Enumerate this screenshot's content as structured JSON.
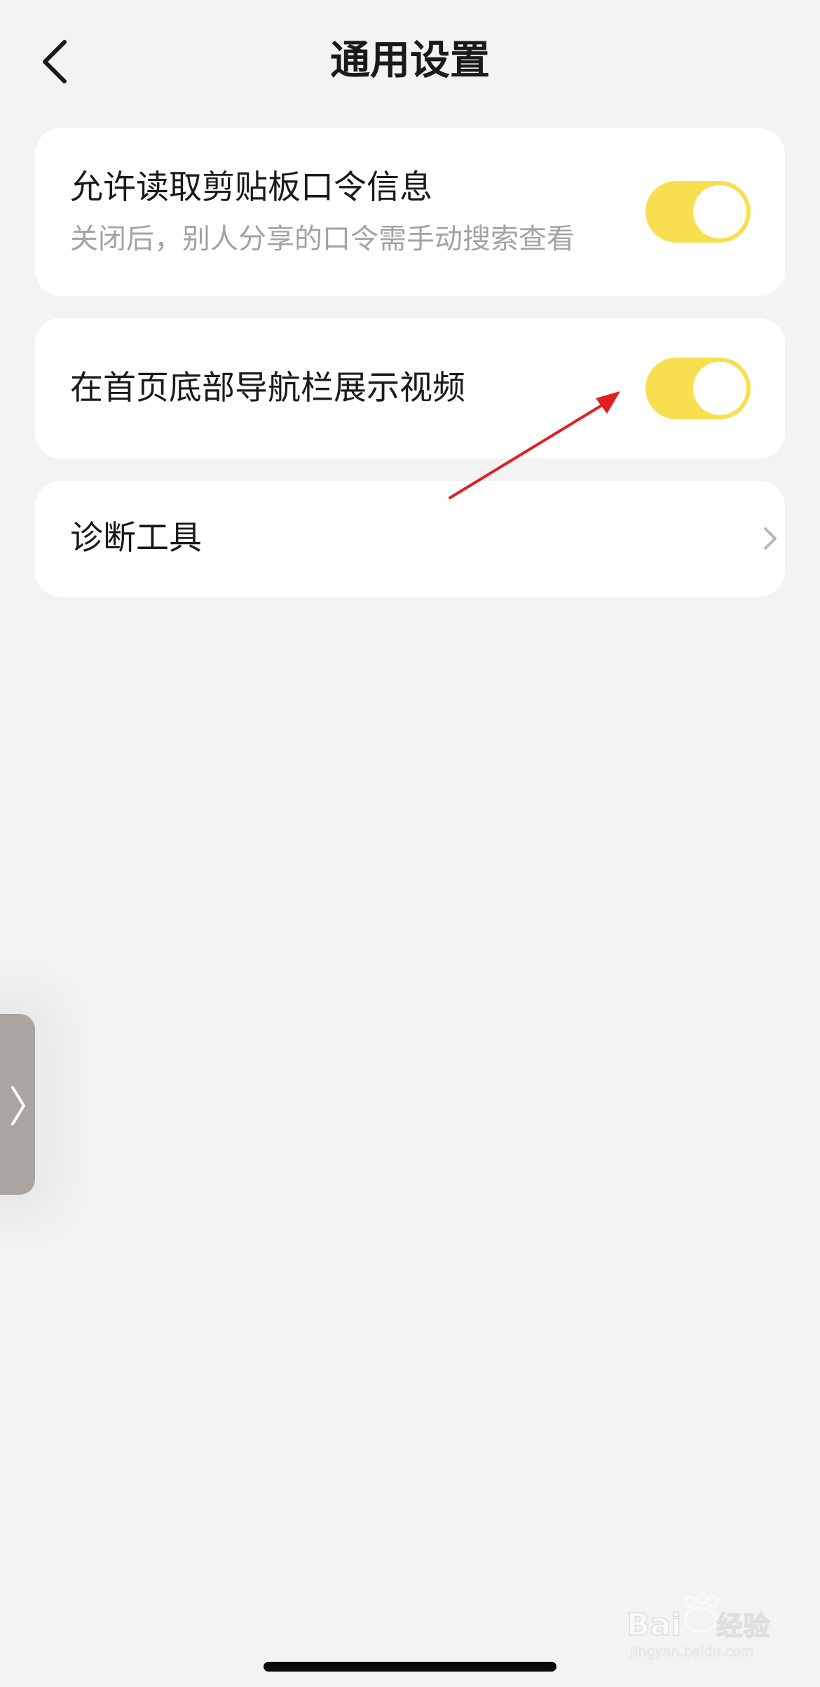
{
  "header": {
    "title": "通用设置",
    "back_icon": "chevron-left-icon"
  },
  "settings": [
    {
      "title": "允许读取剪贴板口令信息",
      "subtitle": "关闭后，别人分享的口令需手动搜索查看",
      "toggle_on": true
    },
    {
      "title": "在首页底部导航栏展示视频",
      "toggle_on": true
    },
    {
      "title": "诊断工具",
      "trailing_icon": "chevron-right-icon"
    }
  ],
  "side_handle": {
    "icon": "chevron-right-icon"
  },
  "annotation": {
    "type": "arrow",
    "color": "#e02020",
    "points_to": "toggle-show-video"
  },
  "watermark": {
    "brand": "Bai du 经验",
    "url": "jingyan.baidu.com"
  },
  "colors": {
    "background": "#f3f3f3",
    "card": "#ffffff",
    "toggle_on": "#f8df4f",
    "subtitle": "#a3a3a3"
  }
}
